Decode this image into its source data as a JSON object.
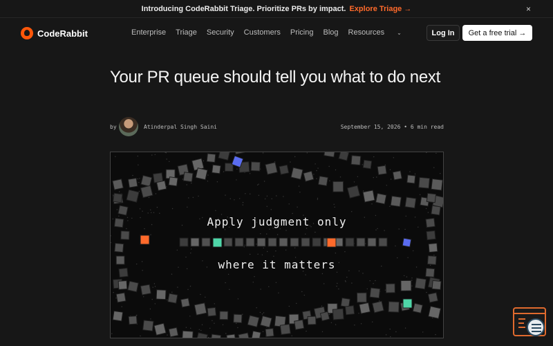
{
  "announcement": {
    "text": "Introducing CodeRabbit Triage. Prioritize PRs by impact.",
    "cta": "Explore Triage →",
    "close": "×"
  },
  "nav": {
    "logo": "CodeRabbit",
    "items": [
      "Enterprise",
      "Triage",
      "Security",
      "Customers",
      "Pricing",
      "Blog",
      "Resources"
    ],
    "login": "Log In",
    "trial": "Get a free trial →"
  },
  "article": {
    "title": "Your PR queue should tell you what to do next",
    "by": "by",
    "author": "Atinderpal Singh Saini",
    "meta": "September 15, 2026  •  6 min read"
  },
  "hero": {
    "line1": "Apply judgment only",
    "line2": "where it matters"
  },
  "colors": {
    "accent": "#ff6a2b",
    "brand": "#ff570a",
    "tile_green": "#4fd6a8",
    "tile_blue": "#5a6cf0"
  }
}
